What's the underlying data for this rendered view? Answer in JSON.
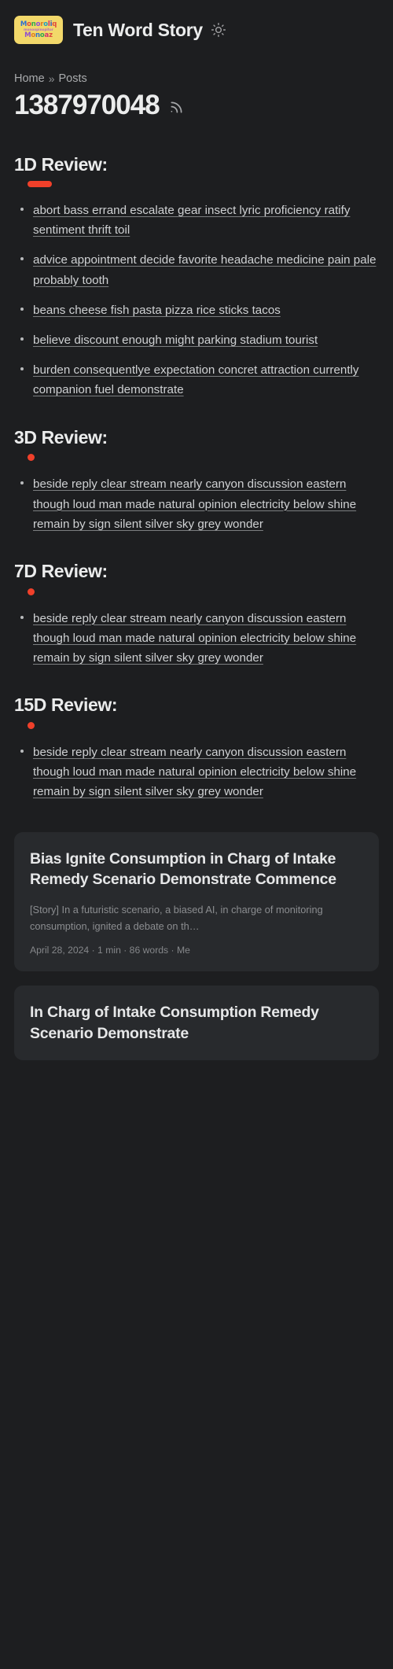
{
  "header": {
    "logo": {
      "icon": "site-logo",
      "line1": "Monoroliq",
      "line2": "monoopinopitor",
      "line3": "Monoaz"
    },
    "site_title": "Ten Word Story",
    "theme_toggle_icon": "sun-icon",
    "theme_toggle_label": "Toggle theme"
  },
  "breadcrumb": {
    "home": "Home",
    "separator": "»",
    "current": "Posts"
  },
  "post_id": "1387970048",
  "rss_icon": "rss-icon",
  "reviews": [
    {
      "heading": "1D Review:",
      "accent": "bar",
      "accent_color": "#f0402a",
      "items": [
        "abort bass errand escalate gear insect lyric proficiency ratify sentiment thrift toil",
        "advice appointment decide favorite headache medicine pain pale probably tooth",
        "beans cheese fish pasta pizza rice sticks tacos",
        "believe discount enough might parking stadium tourist",
        "burden consequentlye expectation concret attraction currently companion fuel demonstrate"
      ]
    },
    {
      "heading": "3D Review:",
      "accent": "dot",
      "accent_color": "#f0402a",
      "items": [
        "beside reply clear stream nearly canyon discussion eastern though loud man made natural opinion electricity below shine remain by sign silent silver sky grey wonder"
      ]
    },
    {
      "heading": "7D Review:",
      "accent": "dot",
      "accent_color": "#f0402a",
      "items": [
        "beside reply clear stream nearly canyon discussion eastern though loud man made natural opinion electricity below shine remain by sign silent silver sky grey wonder"
      ]
    },
    {
      "heading": "15D Review:",
      "accent": "dot",
      "accent_color": "#f0402a",
      "items": [
        "beside reply clear stream nearly canyon discussion eastern though loud man made natural opinion electricity below shine remain by sign silent silver sky grey wonder"
      ]
    }
  ],
  "cards": [
    {
      "title": "Bias Ignite Consumption in Charg of Intake Remedy Scenario Demonstrate Commence",
      "excerpt": "[Story] In a futuristic scenario, a biased AI, in charge of monitoring consumption, ignited a debate on th…",
      "meta": "April 28, 2024 · 1 min · 86 words · Me"
    },
    {
      "title": "In Charg of Intake Consumption Remedy Scenario Demonstrate",
      "excerpt": "",
      "meta": ""
    }
  ],
  "colors": {
    "background": "#1d1e20",
    "card": "#282a2d",
    "accent": "#f0402a",
    "text": "#ebecec",
    "muted": "#8b8d90",
    "logo_bg": "#f2d86a"
  }
}
